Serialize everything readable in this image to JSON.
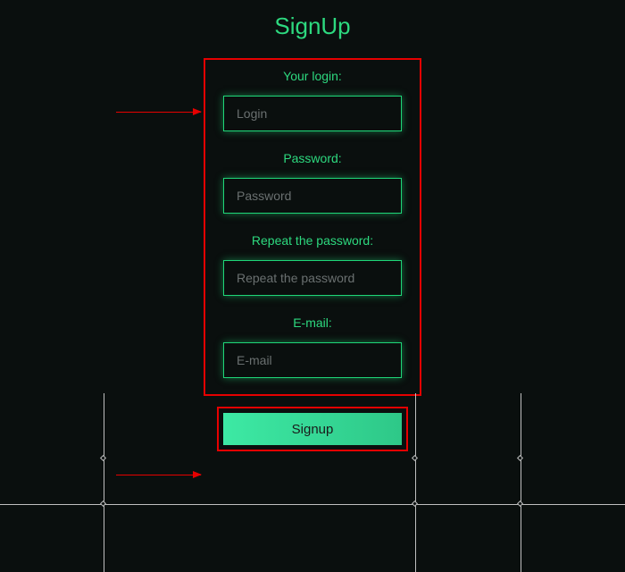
{
  "title": "SignUp",
  "form": {
    "login": {
      "label": "Your login:",
      "placeholder": "Login"
    },
    "password": {
      "label": "Password:",
      "placeholder": "Password"
    },
    "repeat_password": {
      "label": "Repeat the password:",
      "placeholder": "Repeat the password"
    },
    "email": {
      "label": "E-mail:",
      "placeholder": "E-mail"
    }
  },
  "signup_button": "Signup",
  "colors": {
    "accent_green": "#2dd97f",
    "input_border": "#1fd678",
    "annotation_red": "#e60000",
    "background": "#0a0f0e",
    "button_gradient_start": "#3de9a4",
    "button_gradient_end": "#2ec888"
  }
}
